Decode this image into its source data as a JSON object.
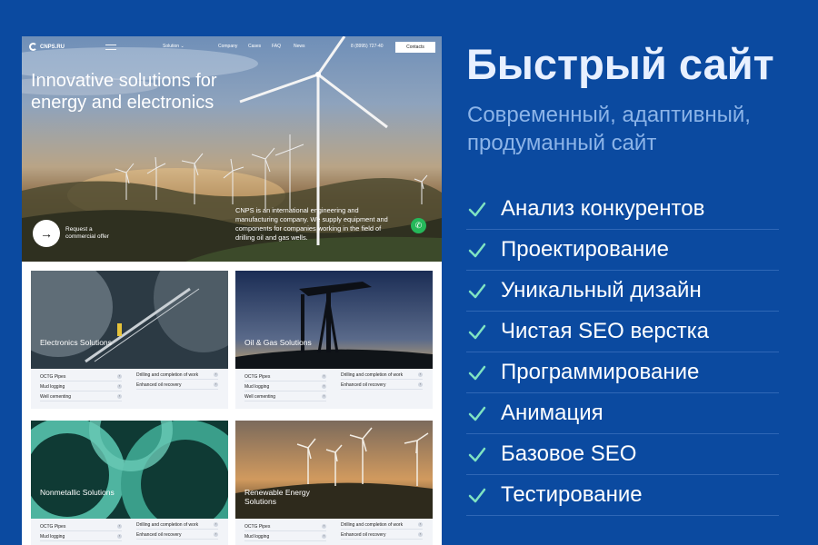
{
  "site": {
    "logo": "CNPS.RU",
    "nav": {
      "solution": "Solution",
      "company": "Company",
      "cases": "Cases",
      "faq": "FAQ",
      "news": "News",
      "phone": "8 (8995) 727-40",
      "contacts": "Contacts"
    },
    "hero": {
      "title": "Innovative solutions for energy and electronics",
      "description": "CNPS is an international engineering and manufacturing company. We supply equipment and components for companies working in the field of drilling oil and gas wells.",
      "cta": "Request a commercial offer"
    },
    "cards": [
      {
        "title": "Electronics Solutions",
        "items_left": [
          "OCTG Pipes",
          "Mud logging",
          "Well cementing"
        ],
        "items_right": [
          "Drilling and completion of work",
          "Enhanced oil recovery"
        ]
      },
      {
        "title": "Oil & Gas Solutions",
        "items_left": [
          "OCTG Pipes",
          "Mud logging",
          "Well cementing"
        ],
        "items_right": [
          "Drilling and completion of work",
          "Enhanced oil recovery"
        ]
      },
      {
        "title": "Nonmetallic Solutions",
        "items_left": [
          "OCTG Pipes",
          "Mud logging"
        ],
        "items_right": [
          "Drilling and completion of work",
          "Enhanced oil recovery"
        ]
      },
      {
        "title": "Renewable Energy Solutions",
        "items_left": [
          "OCTG Pipes",
          "Mud logging"
        ],
        "items_right": [
          "Drilling and completion of work",
          "Enhanced oil recovery"
        ]
      }
    ]
  },
  "panel": {
    "headline": "Быстрый сайт",
    "subheadline": "Современный, адаптивный, продуманный сайт",
    "features": [
      "Анализ конкурентов",
      "Проектирование",
      "Уникальный дизайн",
      "Чистая SEO верстка",
      "Программирование",
      "Анимация",
      "Базовое SEO",
      "Тестирование"
    ]
  },
  "colors": {
    "background": "#0b4aa0",
    "check": "#7fe3c2",
    "subhead": "#8cb4e8",
    "whatsapp": "#25b85a"
  },
  "icons": [
    "logo-icon",
    "menu-icon",
    "chevron-down-icon",
    "arrow-right-icon",
    "whatsapp-icon",
    "check-icon"
  ]
}
